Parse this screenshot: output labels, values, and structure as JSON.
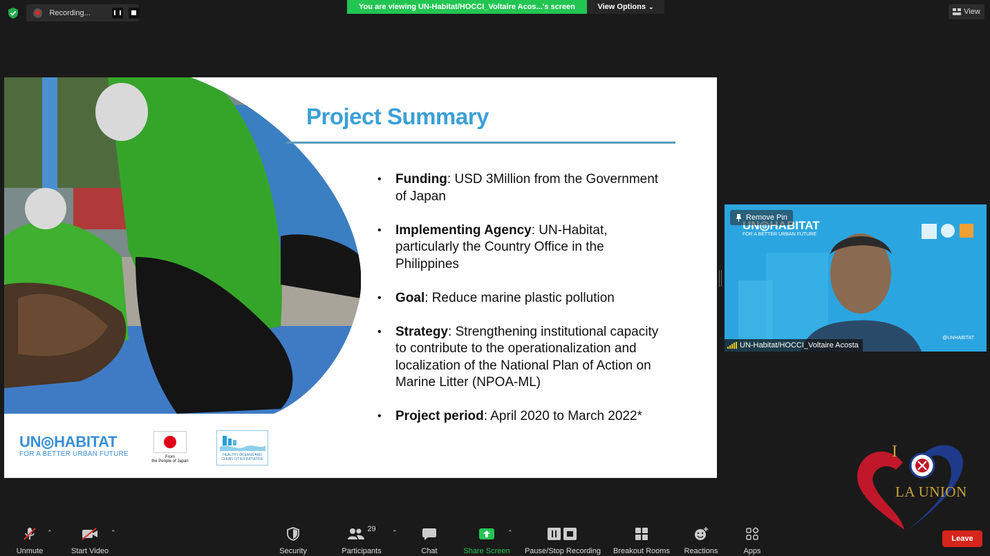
{
  "top_bar": {
    "recording_label": "Recording...",
    "viewing_banner": "You are viewing UN-Habitat/HOCCI_Voltaire Acos...'s screen",
    "view_options_label": "View Options",
    "view_label": "View"
  },
  "slide": {
    "title": "Project Summary",
    "bullets": [
      {
        "label": "Funding",
        "text": ": USD 3Million from the Government of Japan"
      },
      {
        "label": "Implementing Agency",
        "text": ": UN-Habitat, particularly the Country Office in the Philippines"
      },
      {
        "label": "Goal",
        "text": ":  Reduce marine plastic pollution"
      },
      {
        "label": "Strategy",
        "text": ": Strengthening institutional capacity to contribute to the operationalization and localization of the National Plan of Action on Marine Litter (NPOA-ML)"
      },
      {
        "label": "Project period",
        "text": ":  April 2020 to March 2022*"
      }
    ],
    "logo_un_text": "UN◎HABITAT",
    "logo_un_tagline": "FOR A BETTER URBAN FUTURE",
    "logo_japan_caption_1": "From",
    "logo_japan_caption_2": "the People of Japan",
    "logo_hocci_caption": "HEALTHY OCEANS AND CLEAN CITIES INITIATIVE"
  },
  "participant_tile": {
    "remove_pin_label": "Remove Pin",
    "name": "UN-Habitat/HOCCI_Voltaire Acosta",
    "bg_logo_text": "UN◎HABITAT",
    "bg_logo_tagline": "FOR A BETTER URBAN FUTURE",
    "bg_handle": "@UNHABITAT"
  },
  "branding": {
    "i_letter": "I",
    "place_name": "LA UNION"
  },
  "toolbar": {
    "unmute": "Unmute",
    "start_video": "Start Video",
    "security": "Security",
    "participants": "Participants",
    "participants_count": "29",
    "chat": "Chat",
    "share_screen": "Share Screen",
    "pause_stop_recording": "Pause/Stop Recording",
    "breakout_rooms": "Breakout Rooms",
    "reactions": "Reactions",
    "apps": "Apps",
    "leave": "Leave"
  },
  "colors": {
    "share_green": "#23c552",
    "leave_red": "#d6251d",
    "title_blue": "#3ca0d5"
  }
}
